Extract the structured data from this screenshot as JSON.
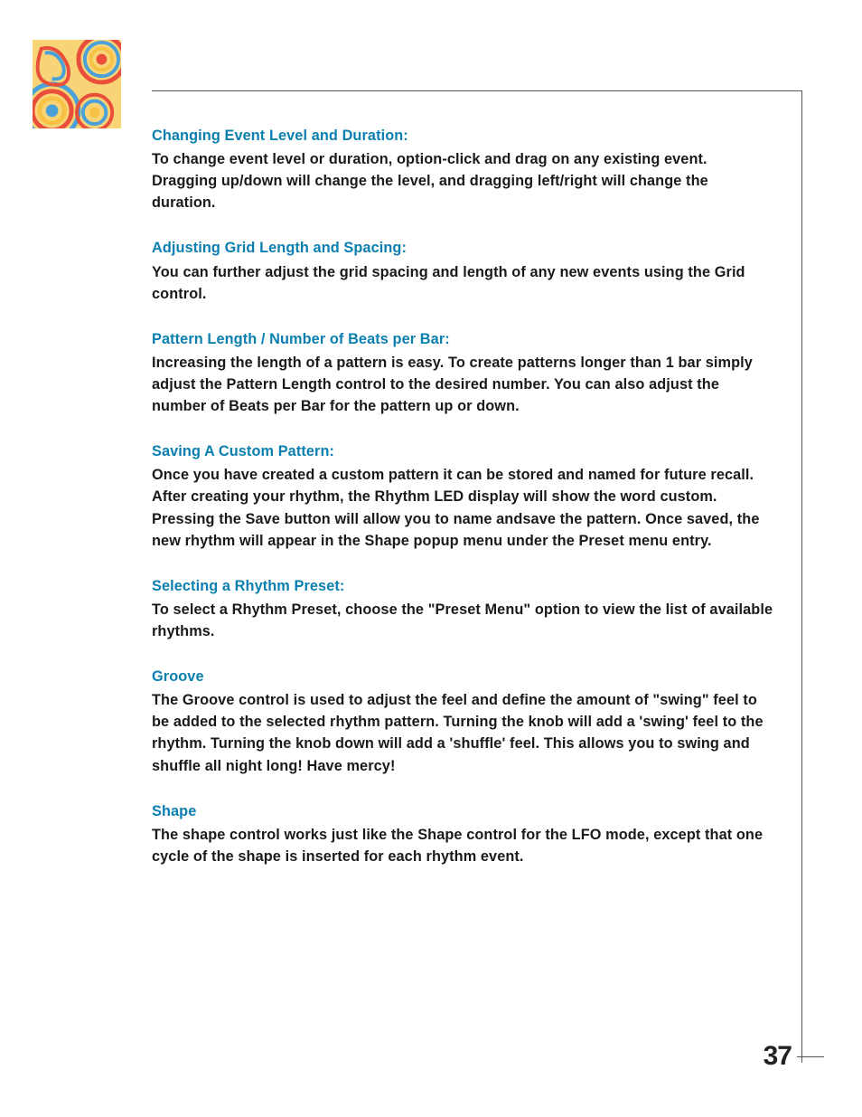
{
  "sections": [
    {
      "heading": "Changing Event Level and Duration:",
      "body": "To change event level or duration, option-click and drag on any existing event. Dragging up/down will change the level, and dragging left/right will change the duration."
    },
    {
      "heading": "Adjusting Grid Length and Spacing:",
      "body": "You can further adjust the grid spacing and length of any new events using the Grid control."
    },
    {
      "heading": "Pattern Length / Number of Beats per Bar:",
      "body": "Increasing the length of a pattern is easy. To create patterns longer than 1 bar simply adjust the Pattern Length control to the desired number. You can also adjust the number of Beats per Bar for the pattern up or down."
    },
    {
      "heading": "Saving A Custom Pattern:",
      "body": "Once you have created a custom pattern it can be stored and named for future recall. After creating your rhythm, the Rhythm LED display will show the word custom. Pressing the  Save button will allow you to name andsave the pattern. Once saved, the new rhythm will appear in the Shape popup menu under the Preset menu entry."
    },
    {
      "heading": "Selecting a Rhythm Preset:",
      "body": "To select a Rhythm Preset, choose the \"Preset Menu\" option to view the list of available rhythms."
    },
    {
      "heading": "Groove",
      "body": "The Groove control is used to adjust the feel and define the amount of  \"swing\" feel to be added to the selected rhythm pattern. Turning the knob will add a 'swing' feel to the rhythm. Turning the knob down will add a 'shuffle' feel. This allows you to swing and shuffle all night long! Have mercy!"
    },
    {
      "heading": "Shape",
      "body": "The shape control works just like the Shape control for the LFO mode, except that one cycle of the shape is inserted for each rhythm event."
    }
  ],
  "page_number": "37"
}
